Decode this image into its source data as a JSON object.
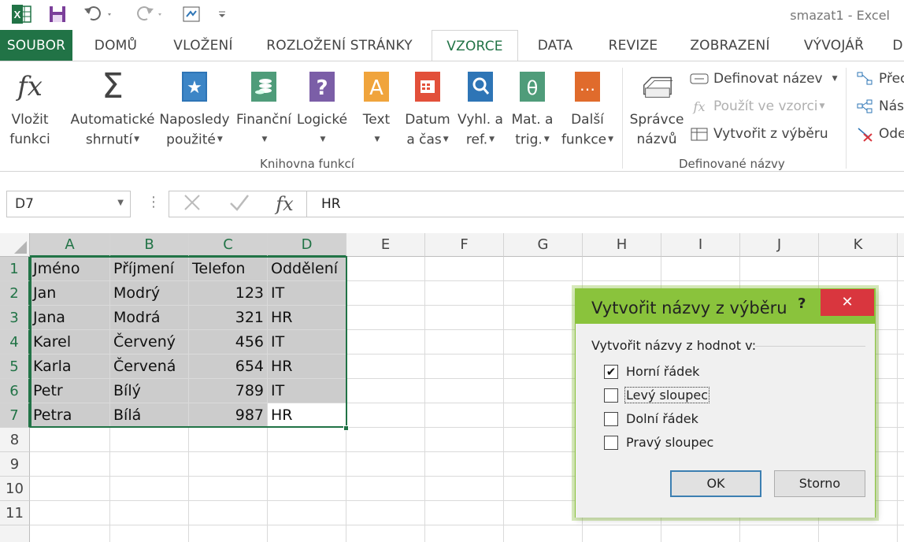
{
  "window": {
    "title": "smazat1 - Excel"
  },
  "tabs": [
    "SOUBOR",
    "DOMŮ",
    "VLOŽENÍ",
    "ROZLOŽENÍ STRÁNKY",
    "VZORCE",
    "DATA",
    "REVIZE",
    "ZOBRAZENÍ",
    "VÝVOJÁŘ",
    "D"
  ],
  "active_tab": "VZORCE",
  "ribbon": {
    "insert_function": {
      "line1": "Vložit",
      "line2": "funkci"
    },
    "autosum": {
      "line1": "Automatické",
      "line2": "shrnutí"
    },
    "recent": {
      "line1": "Naposledy",
      "line2": "použité"
    },
    "financial": {
      "line1": "Finanční"
    },
    "logical": {
      "line1": "Logické"
    },
    "text": {
      "line1": "Text"
    },
    "datetime": {
      "line1": "Datum",
      "line2": "a čas"
    },
    "lookup": {
      "line1": "Vyhl. a",
      "line2": "ref."
    },
    "math": {
      "line1": "Mat. a",
      "line2": "trig."
    },
    "more": {
      "line1": "Další",
      "line2": "funkce"
    },
    "library_label": "Knihovna funkcí",
    "name_manager": {
      "line1": "Správce",
      "line2": "názvů"
    },
    "define_name": "Definovat název",
    "use_in_formula": "Použít ve vzorci",
    "create_from_selection": "Vytvořit z výběru",
    "names_label": "Definované názvy",
    "trace_precedents": "Přec",
    "trace_dependents": "Nás",
    "remove_arrows": "Ode"
  },
  "formula_bar": {
    "name_box": "D7",
    "content": "HR",
    "fx": "fx"
  },
  "grid": {
    "columns": [
      "A",
      "B",
      "C",
      "D",
      "E",
      "F",
      "G",
      "H",
      "I",
      "J",
      "K"
    ],
    "rows": [
      "1",
      "2",
      "3",
      "4",
      "5",
      "6",
      "7",
      "8",
      "9",
      "10",
      "11"
    ],
    "cells": [
      [
        "Jméno",
        "Příjmení",
        "Telefon",
        "Oddělení"
      ],
      [
        "Jan",
        "Modrý",
        "123",
        "IT"
      ],
      [
        "Jana",
        "Modrá",
        "321",
        "HR"
      ],
      [
        "Karel",
        "Červený",
        "456",
        "IT"
      ],
      [
        "Karla",
        "Červená",
        "654",
        "HR"
      ],
      [
        "Petr",
        "Bílý",
        "789",
        "IT"
      ],
      [
        "Petra",
        "Bílá",
        "987",
        "HR"
      ]
    ]
  },
  "dialog": {
    "title": "Vytvořit názvy z výběru",
    "help": "?",
    "close": "✕",
    "group_label": "Vytvořit názvy z hodnot v:",
    "options": [
      {
        "label": "Horní řádek",
        "checked": true
      },
      {
        "label": "Levý sloupec",
        "checked": false
      },
      {
        "label": "Dolní řádek",
        "checked": false
      },
      {
        "label": "Pravý sloupec",
        "checked": false
      }
    ],
    "ok": "OK",
    "cancel": "Storno"
  },
  "colors": {
    "accent": "#217346",
    "dialog_frame": "#8ac33c",
    "close": "#d9363e",
    "selection": "#cccccc"
  }
}
